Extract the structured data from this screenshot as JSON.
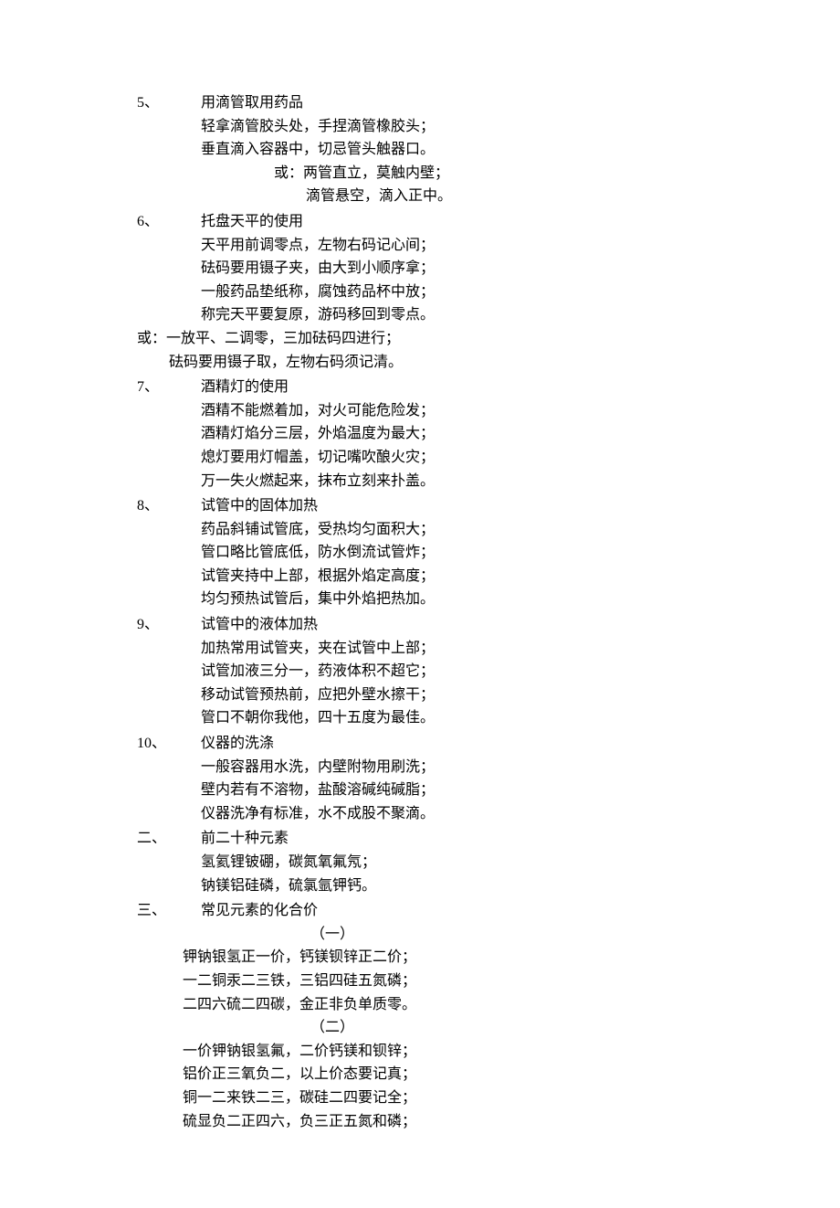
{
  "items": [
    {
      "num": "5、",
      "title": "用滴管取用药品",
      "lines": [
        "轻拿滴管胶头处，手捏滴管橡胶头；",
        "垂直滴入容器中，切忌管头触器口。"
      ],
      "sublines": [
        "或：两管直立，莫触内壁；",
        "滴管悬空，滴入正中。"
      ]
    },
    {
      "num": "6、",
      "title": "托盘天平的使用",
      "lines": [
        "天平用前调零点，左物右码记心间；",
        "砝码要用镊子夹，由大到小顺序拿；",
        "一般药品垫纸称，腐蚀药品杯中放；",
        "称完天平要复原，游码移回到零点。"
      ],
      "orlines": [
        "或：一放平、二调零，三加砝码四进行；",
        "砝码要用镊子取，左物右码须记清。"
      ]
    },
    {
      "num": "7、",
      "title": "酒精灯的使用",
      "lines": [
        "酒精不能燃着加，对火可能危险发；",
        "酒精灯焰分三层，外焰温度为最大；",
        "熄灯要用灯帽盖，切记嘴吹酿火灾；",
        "万一失火燃起来，抹布立刻来扑盖。"
      ]
    },
    {
      "num": "8、",
      "title": "试管中的固体加热",
      "lines": [
        "药品斜铺试管底，受热均匀面积大；",
        "管口略比管底低，防水倒流试管炸；",
        "试管夹持中上部，根据外焰定高度；",
        "均匀预热试管后，集中外焰把热加。"
      ]
    },
    {
      "num": "9、",
      "title": "试管中的液体加热",
      "lines": [
        "加热常用试管夹，夹在试管中上部；",
        "试管加液三分一，药液体积不超它；",
        "移动试管预热前，应把外壁水擦干；",
        "管口不朝你我他，四十五度为最佳。"
      ]
    },
    {
      "num": "10、",
      "title": "仪器的洗涤",
      "lines": [
        "一般容器用水洗，内壁附物用刷洗；",
        "壁内若有不溶物，盐酸溶碱纯碱脂；",
        "仪器洗净有标准，水不成股不聚滴。"
      ]
    }
  ],
  "section2": {
    "num": "二、",
    "title": "前二十种元素",
    "lines": [
      "氢氦锂铍硼，碳氮氧氟氖；",
      "钠镁铝硅磷，硫氯氩钾钙。"
    ]
  },
  "section3": {
    "num": "三、",
    "title": "常见元素的化合价",
    "part1_label": "（一）",
    "part1_lines": [
      "钾钠银氢正一价，钙镁钡锌正二价；",
      "一二铜汞二三铁，三铝四硅五氮磷；",
      "二四六硫二四碳，金正非负单质零。"
    ],
    "part2_label": "（二）",
    "part2_lines": [
      "一价钾钠银氢氟，二价钙镁和钡锌；",
      "铝价正三氧负二，以上价态要记真；",
      "铜一二来铁二三，碳硅二四要记全；",
      "硫显负二正四六，负三正五氮和磷；"
    ]
  }
}
